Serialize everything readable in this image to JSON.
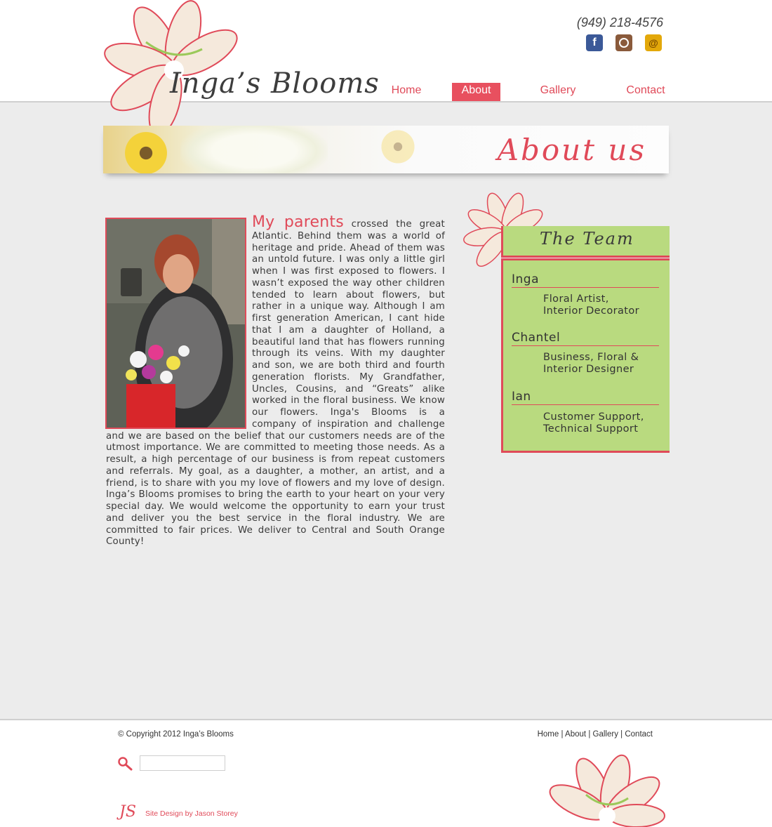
{
  "brand": {
    "logo_text": "Inga’s Blooms"
  },
  "contact": {
    "phone": "(949) 218-4576"
  },
  "social": [
    {
      "name": "facebook-icon",
      "glyph": "f"
    },
    {
      "name": "instagram-icon",
      "glyph": ""
    },
    {
      "name": "email-icon",
      "glyph": "@"
    }
  ],
  "nav": {
    "items": [
      {
        "label": "Home",
        "active": false
      },
      {
        "label": "About",
        "active": true
      },
      {
        "label": "Gallery",
        "active": false
      },
      {
        "label": "Contact",
        "active": false
      }
    ]
  },
  "banner": {
    "title": "About us"
  },
  "about": {
    "lead": "My parents",
    "paragraph": "crossed the great Atlantic. Behind them was a world of heritage and pride. Ahead of them was an untold future. I was only a little girl when I was first exposed to flowers. I wasn’t exposed the way other children tended to learn about flowers, but rather in a unique way. Although I am first generation American, I cant hide that I am a daughter of Holland, a beautiful land that has flowers running through its veins. With my daughter and son, we are both third and fourth generation florists. My Grandfather, Uncles, Cousins, and “Greats” alike worked in the floral business. We know our flowers. Inga's Blooms is a company of inspiration and challenge and we are based on the belief that our customers needs are of the utmost importance. We are committed to meeting those needs. As a result, a high percentage of our business is from repeat customers and referrals. My goal, as a daughter, a mother, an artist, and a friend, is to share with you my love of flowers and my love of design. Inga’s Blooms promises to bring the earth to your heart on your very special day. We would welcome the opportunity to earn your trust and deliver you the best service in the floral industry. We are committed to fair prices. We deliver to Central and South Orange County!"
  },
  "team": {
    "title": "The Team",
    "members": [
      {
        "name": "Inga",
        "role_line1": "Floral Artist,",
        "role_line2": "Interior Decorator"
      },
      {
        "name": "Chantel",
        "role_line1": "Business, Floral &",
        "role_line2": "Interior Designer"
      },
      {
        "name": "Ian",
        "role_line1": "Customer Support,",
        "role_line2": "Technical Support"
      }
    ]
  },
  "footer": {
    "copyright": "© Copyright 2012 Inga’s Blooms",
    "nav": [
      "Home",
      "About",
      "Gallery",
      "Contact"
    ],
    "separator": "|",
    "search_placeholder": "",
    "js_mark": "JS",
    "credit": "Site Design by Jason Storey"
  },
  "colors": {
    "accent": "#e04a59",
    "team_green": "#b9da7f",
    "background": "#ececec"
  }
}
